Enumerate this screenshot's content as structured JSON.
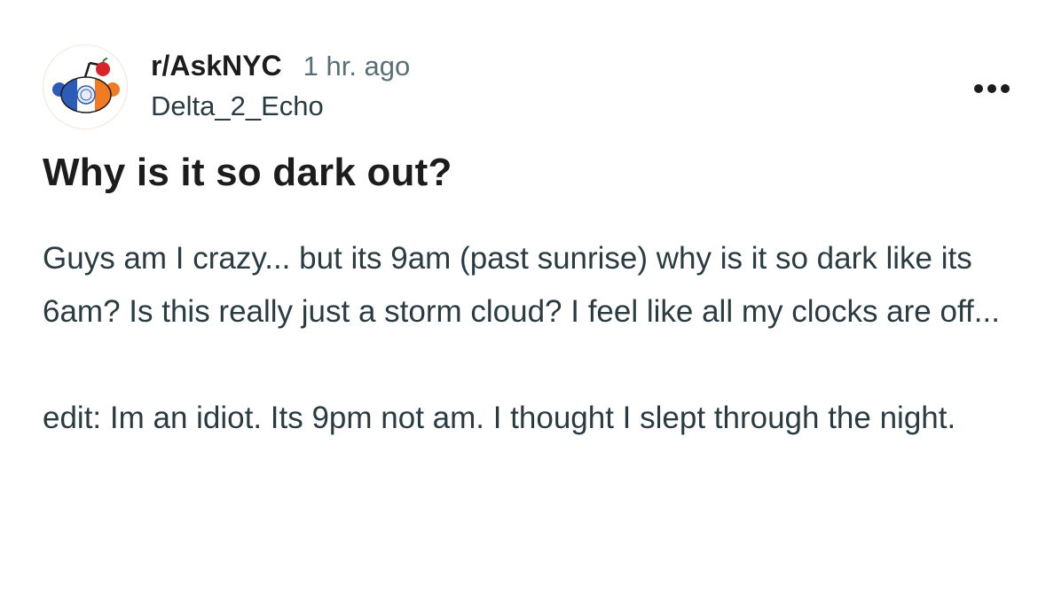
{
  "post": {
    "subreddit": "r/AskNYC",
    "time": "1 hr. ago",
    "username": "Delta_2_Echo",
    "title": "Why is it so dark out?",
    "body": [
      "Guys am I crazy... but its 9am (past sunrise) why is it so dark like its 6am? Is this really just a storm cloud? I feel like all my clocks are off...",
      "edit: Im an idiot. Its 9pm not am. I thought I slept through the night."
    ]
  },
  "icons": {
    "avatar": "subreddit-avatar-icon",
    "more": "more-options-icon"
  },
  "colors": {
    "title": "#1c1c1c",
    "body": "#2a3c42",
    "time": "#576f76",
    "flag_blue": "#2c5bb8",
    "flag_orange": "#f07b23",
    "apple_red": "#d8232a"
  }
}
